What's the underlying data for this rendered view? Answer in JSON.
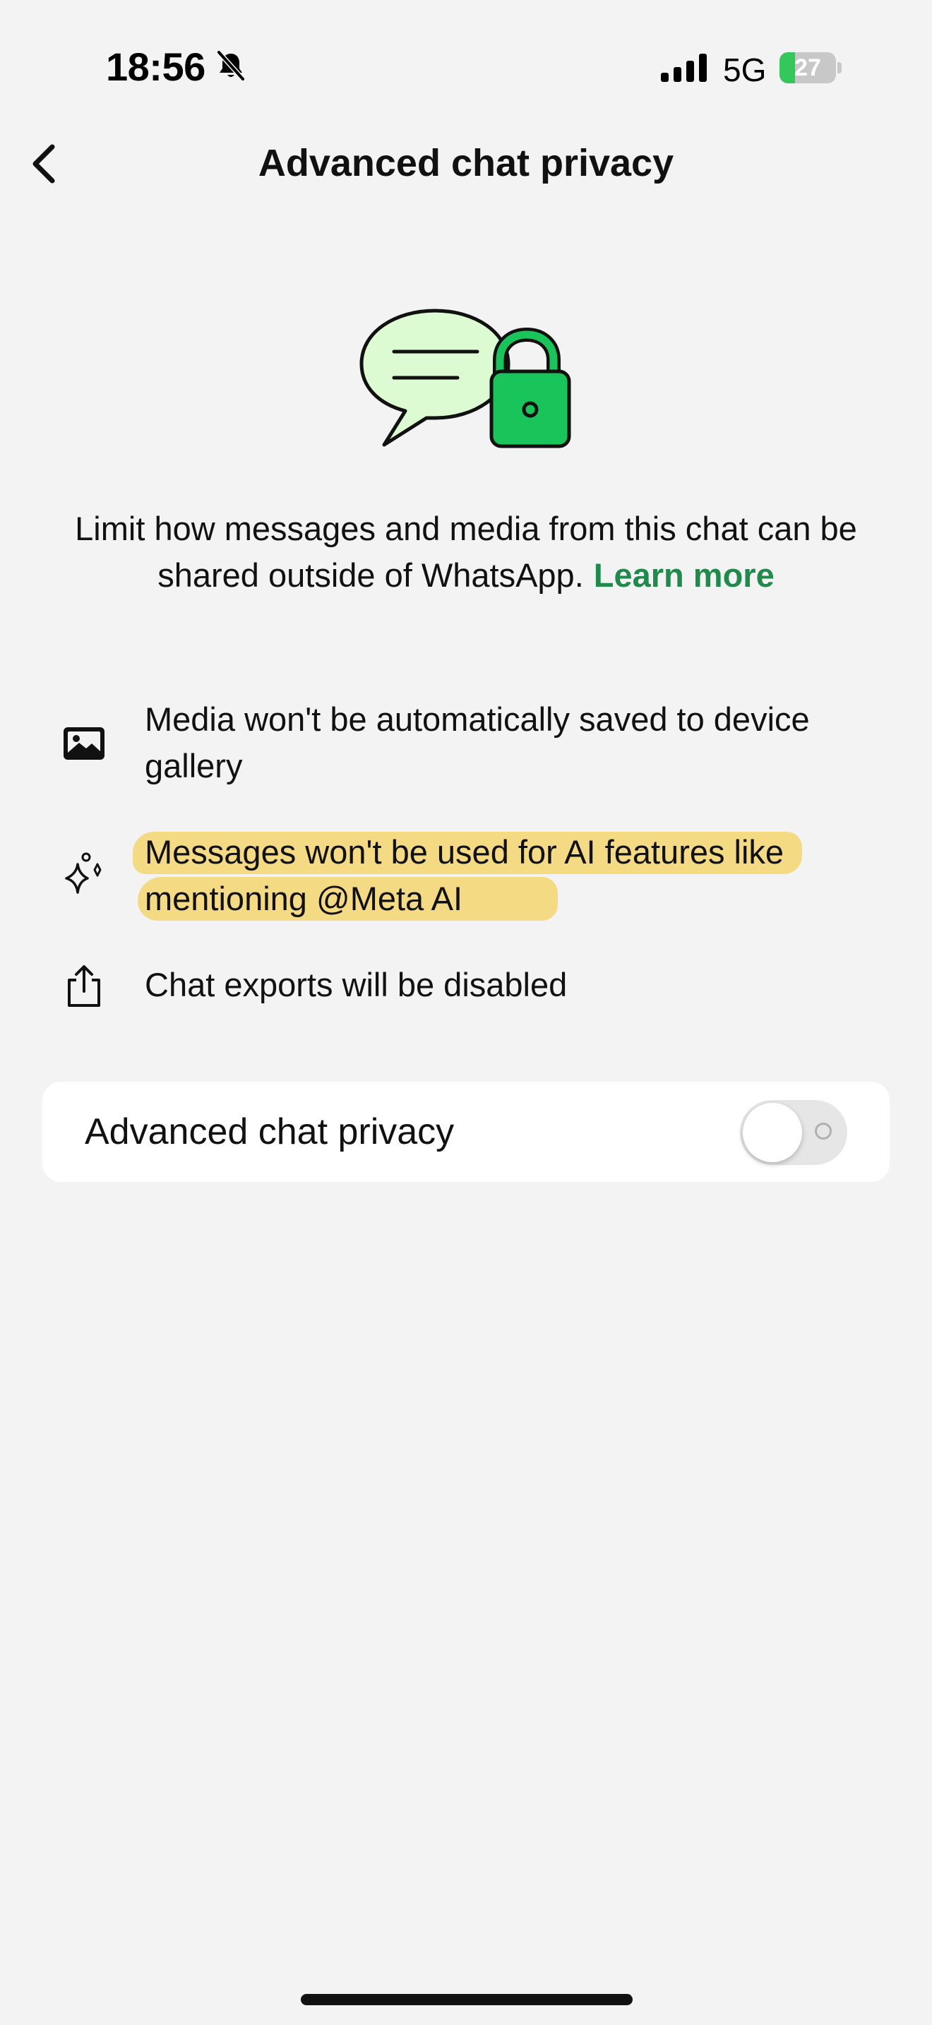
{
  "status_bar": {
    "time": "18:56",
    "network": "5G",
    "battery_percent": 27,
    "battery_label": "27",
    "icons": [
      "bell-slash-icon",
      "signal-bars-icon",
      "battery-charging-icon"
    ]
  },
  "header": {
    "title": "Advanced chat privacy",
    "back_icon": "chevron-left-icon"
  },
  "illustration": {
    "icons": [
      "chat-bubble-icon",
      "padlock-icon"
    ]
  },
  "description": {
    "text": "Limit how messages and media from this chat can be shared outside of WhatsApp.",
    "link_label": "Learn more"
  },
  "features": [
    {
      "icon": "image-icon",
      "text": "Media won't be automatically saved to device gallery"
    },
    {
      "icon": "sparkles-icon",
      "text": "Messages won't be used for AI features like mentioning @Meta AI"
    },
    {
      "icon": "share-icon",
      "text": "Chat exports will be disabled"
    }
  ],
  "setting": {
    "label": "Advanced chat privacy",
    "enabled": false
  },
  "colors": {
    "background": "#f3f3f3",
    "accent_green": "#1f8a4c",
    "illustration_green": "#19c55a",
    "bubble_fill": "#dcfbd2",
    "highlight": "#f4cd46",
    "battery_green": "#34c759"
  }
}
